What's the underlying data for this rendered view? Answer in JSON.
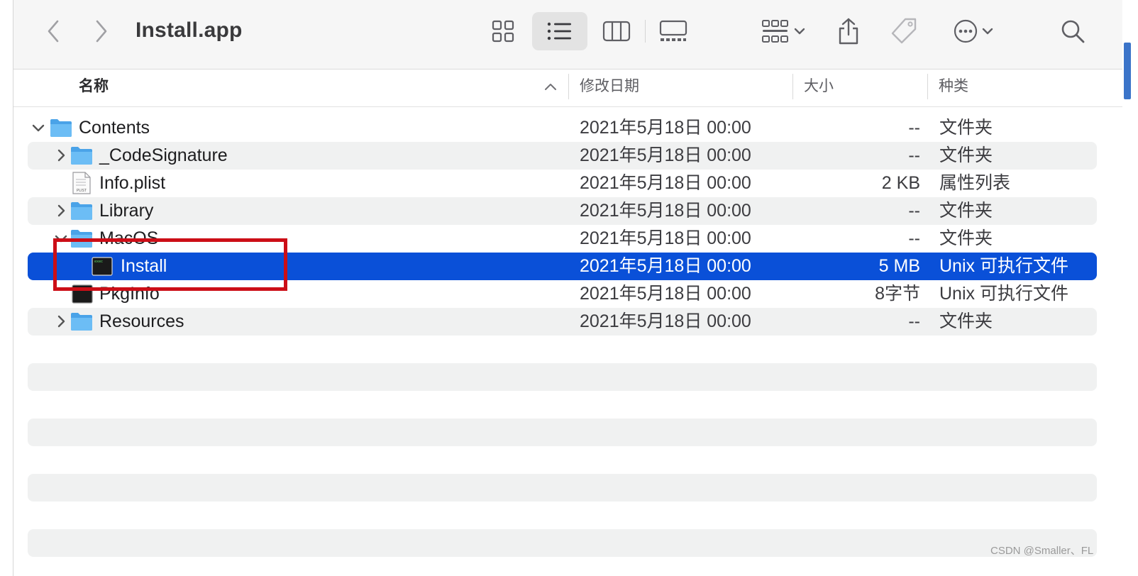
{
  "toolbar": {
    "title": "Install.app",
    "icons": [
      "chevron-left-icon",
      "chevron-right-icon",
      "grid-view-icon",
      "list-view-icon",
      "column-view-icon",
      "gallery-view-icon",
      "group-icon",
      "share-icon",
      "tag-icon",
      "more-icon",
      "search-icon"
    ],
    "active_view": "list"
  },
  "columns": {
    "name": "名称",
    "modified": "修改日期",
    "size": "大小",
    "kind": "种类"
  },
  "rows": [
    {
      "name": "Contents",
      "date": "2021年5月18日 00:00",
      "size": "--",
      "kind": "文件夹",
      "icon": "folder-icon",
      "disclosure": "expanded"
    },
    {
      "name": "_CodeSignature",
      "date": "2021年5月18日 00:00",
      "size": "--",
      "kind": "文件夹",
      "icon": "folder-icon",
      "disclosure": "collapsed"
    },
    {
      "name": "Info.plist",
      "date": "2021年5月18日 00:00",
      "size": "2 KB",
      "kind": "属性列表",
      "icon": "plist-file-icon",
      "disclosure": "none"
    },
    {
      "name": "Library",
      "date": "2021年5月18日 00:00",
      "size": "--",
      "kind": "文件夹",
      "icon": "folder-icon",
      "disclosure": "collapsed"
    },
    {
      "name": "MacOS",
      "date": "2021年5月18日 00:00",
      "size": "--",
      "kind": "文件夹",
      "icon": "folder-icon",
      "disclosure": "expanded"
    },
    {
      "name": "Install",
      "date": "2021年5月18日 00:00",
      "size": "5 MB",
      "kind": "Unix 可执行文件",
      "icon": "terminal-exec-icon",
      "disclosure": "none",
      "selected": true
    },
    {
      "name": "PkgInfo",
      "date": "2021年5月18日 00:00",
      "size": "8字节",
      "kind": "Unix 可执行文件",
      "icon": "terminal-exec-icon",
      "disclosure": "none"
    },
    {
      "name": "Resources",
      "date": "2021年5月18日 00:00",
      "size": "--",
      "kind": "文件夹",
      "icon": "folder-icon",
      "disclosure": "collapsed"
    }
  ],
  "colors": {
    "selection": "#0a50d8",
    "annotation": "#cc0e17",
    "folder": "#5fb3f0"
  },
  "watermark": "CSDN @Smaller、FL"
}
